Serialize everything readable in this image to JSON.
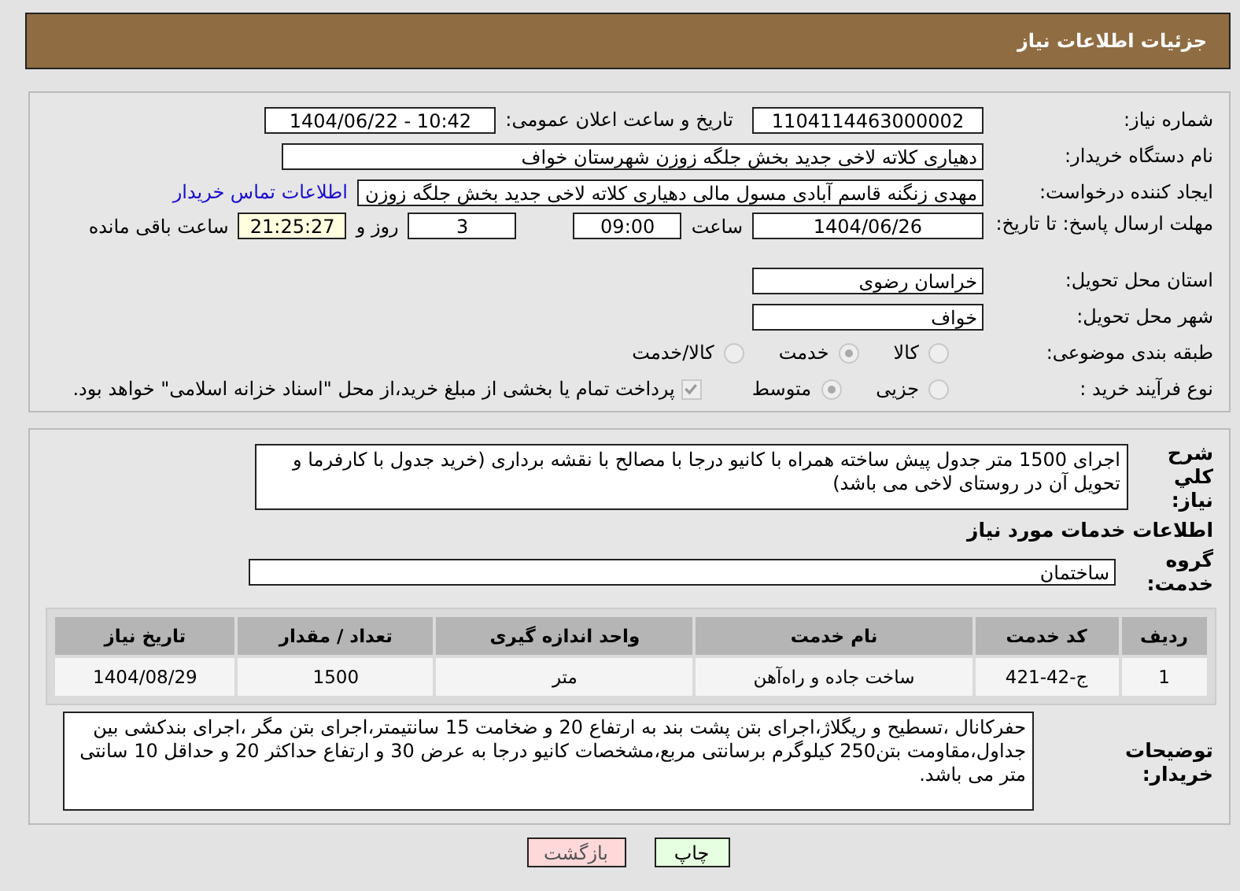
{
  "header": {
    "title": "جزئیات اطلاعات نیاز"
  },
  "need_number": {
    "label": "شماره نیاز:",
    "value": "1104114463000002"
  },
  "announce_datetime": {
    "label": "تاریخ و ساعت اعلان عمومی:",
    "value": "1404/06/22 - 10:42"
  },
  "buyer_org": {
    "label": "نام دستگاه خریدار:",
    "value": "دهیاری کلاته لاخی جدید بخش جلگه زوزن شهرستان خواف"
  },
  "requester": {
    "label": "ایجاد کننده درخواست:",
    "value": "مهدی زنگنه قاسم آبادی مسول مالی دهیاری کلاته لاخی جدید بخش جلگه زوزن",
    "link": "اطلاعات تماس خریدار"
  },
  "deadline": {
    "label": "مهلت ارسال پاسخ: تا تاریخ:",
    "date": "1404/06/26",
    "time_label": "ساعت",
    "time": "09:00",
    "days": "3",
    "days_label": "روز و",
    "remaining": "21:25:27",
    "remaining_label": "ساعت باقی مانده"
  },
  "province": {
    "label": "استان محل تحویل:",
    "value": "خراسان رضوی"
  },
  "city": {
    "label": "شهر محل تحویل:",
    "value": "خواف"
  },
  "category": {
    "label": "طبقه بندی موضوعی:",
    "options": [
      {
        "label": "کالا",
        "selected": false
      },
      {
        "label": "خدمت",
        "selected": true
      },
      {
        "label": "کالا/خدمت",
        "selected": false
      }
    ]
  },
  "purchase_type": {
    "label": "نوع فرآیند خرید :",
    "options": [
      {
        "label": "جزیی",
        "selected": false
      },
      {
        "label": "متوسط",
        "selected": true
      }
    ],
    "payment_note": {
      "label": "پرداخت تمام یا بخشی از مبلغ خرید،از محل \"اسناد خزانه اسلامی\" خواهد بود.",
      "checked": true
    }
  },
  "description": {
    "label": "شرح کلي نياز:",
    "value": "اجرای 1500 متر جدول پیش ساخته همراه با کانیو درجا با مصالح با نقشه برداری (خرید جدول با کارفرما  و تحویل آن در روستای لاخی می باشد)"
  },
  "services_title": "اطلاعات خدمات مورد نیاز",
  "service_group": {
    "label": "گروه خدمت:",
    "value": "ساختمان"
  },
  "table": {
    "columns": [
      "ردیف",
      "کد خدمت",
      "نام خدمت",
      "واحد اندازه گیری",
      "تعداد / مقدار",
      "تاریخ نیاز"
    ],
    "rows": [
      [
        "1",
        "ج-42-421",
        "ساخت جاده و راه‌آهن",
        "متر",
        "1500",
        "1404/08/29"
      ]
    ]
  },
  "buyer_notes": {
    "label": "توضیحات خریدار:",
    "value": "حفرکانال ،تسطیح و ریگلاژ،اجرای بتن پشت بند به ارتفاع 20  و ضخامت 15 سانتیمتر،اجرای بتن مگر ،اجرای بندکشی بین جداول،مقاومت بتن250 کیلوگرم برسانتی مربع،مشخصات  کانیو درجا به عرض 30  و ارتفاع حداکثر 20  و حداقل 10 سانتی متر می باشد."
  },
  "buttons": [
    {
      "label": "چاپ",
      "kind": "print"
    },
    {
      "label": "بازگشت",
      "kind": "back"
    }
  ]
}
